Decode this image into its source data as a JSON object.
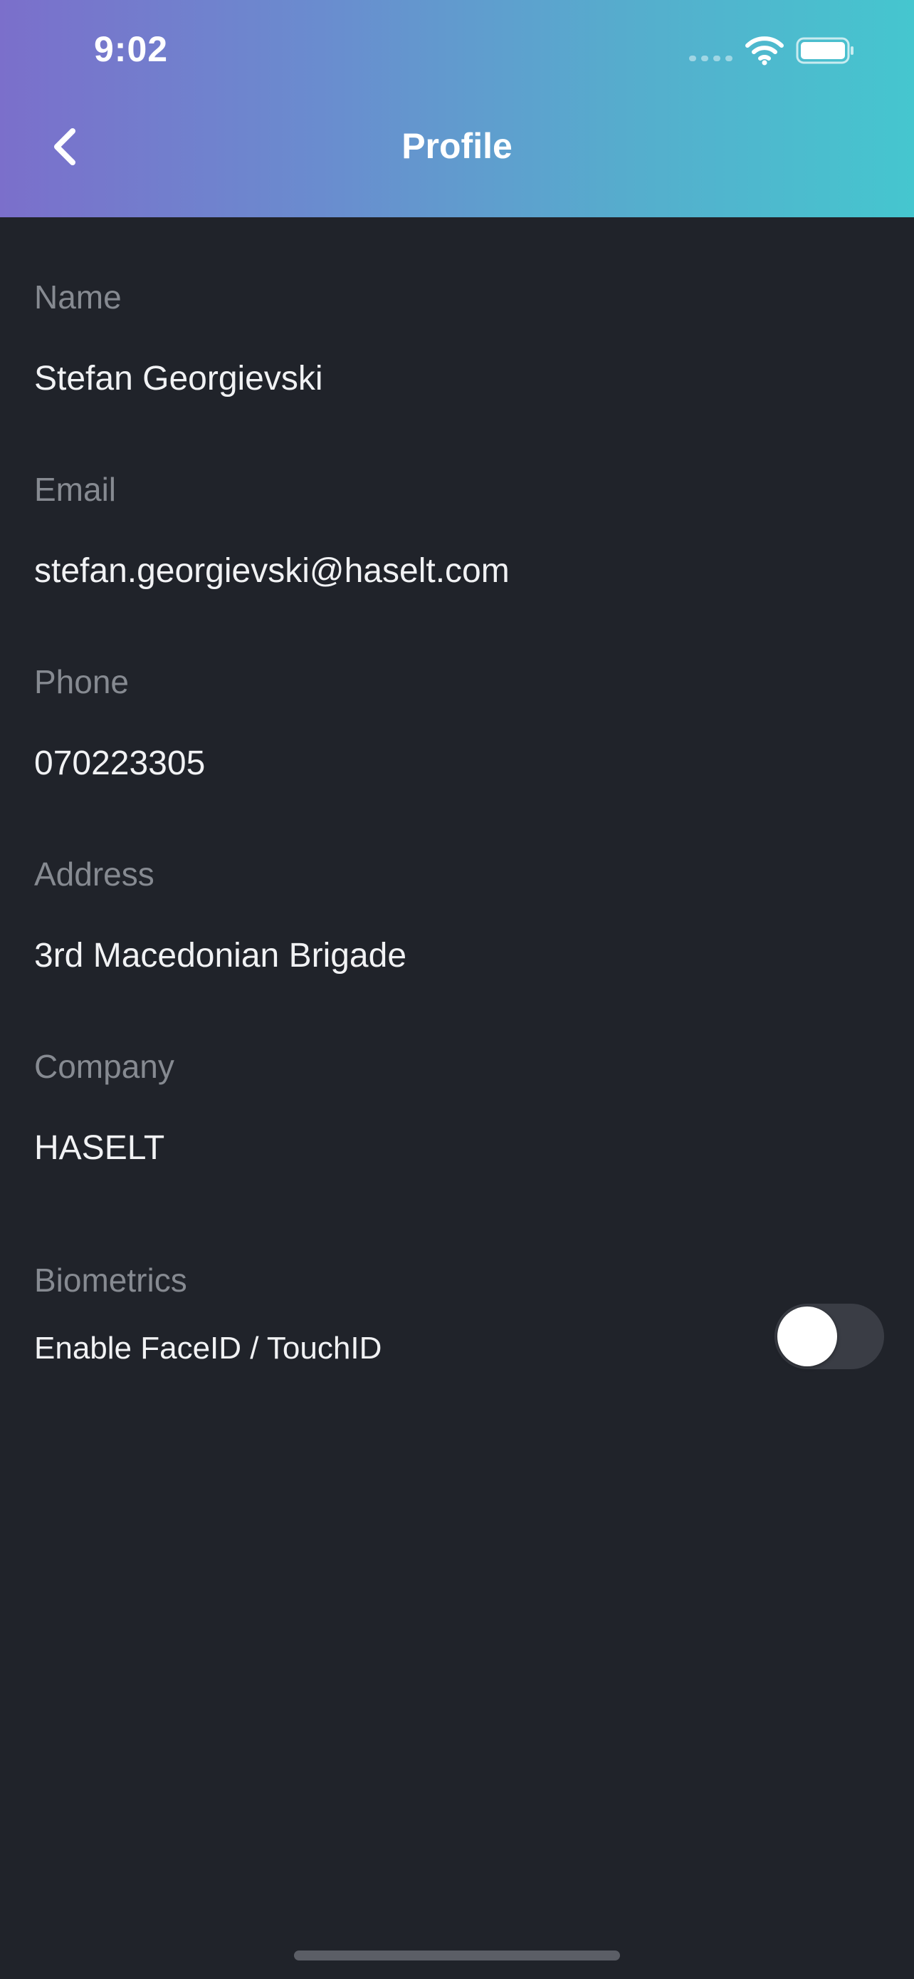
{
  "status_bar": {
    "time": "9:02",
    "icons": [
      "cellular-dots-icon",
      "wifi-icon",
      "battery-icon"
    ]
  },
  "nav": {
    "title": "Profile",
    "back_icon": "chevron-left-icon"
  },
  "fields": {
    "name": {
      "label": "Name",
      "value": "Stefan Georgievski"
    },
    "email": {
      "label": "Email",
      "value": "stefan.georgievski@haselt.com"
    },
    "phone": {
      "label": "Phone",
      "value": "070223305"
    },
    "address": {
      "label": "Address",
      "value": "3rd Macedonian Brigade"
    },
    "company": {
      "label": "Company",
      "value": "HASELT"
    }
  },
  "biometrics": {
    "label": "Biometrics",
    "option_label": "Enable FaceID / TouchID",
    "enabled": false
  },
  "colors": {
    "header_gradient_start": "#7b6fcb",
    "header_gradient_end": "#45c6cf",
    "background": "#20232a",
    "label_text": "#868a91",
    "value_text": "#f1f2f4",
    "toggle_off_track": "#3a3d45"
  }
}
